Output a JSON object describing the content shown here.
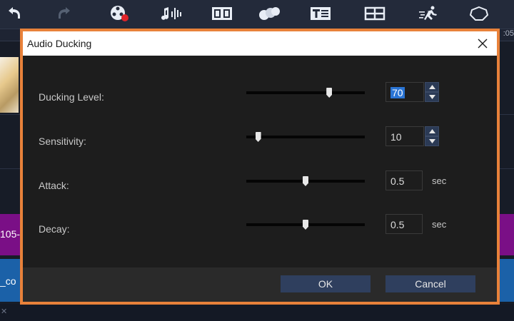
{
  "app": {
    "toolbar_icons": [
      "undo-icon",
      "redo-icon",
      "record-icon",
      "audio-icon",
      "scenes-icon",
      "merge-icon",
      "title-icon",
      "grid-icon",
      "motion-icon",
      "lasso-icon"
    ],
    "ruler_time": ":05",
    "purple_track_label": "105-",
    "blue_track_label": "_co"
  },
  "dialog": {
    "title": "Audio Ducking",
    "close_label": "✕",
    "controls": [
      {
        "label": "Ducking Level:",
        "value": "70",
        "level": 0.7,
        "has_spinner": true,
        "unit": ""
      },
      {
        "label": "Sensitivity:",
        "value": "10",
        "level": 0.1,
        "has_spinner": true,
        "unit": ""
      },
      {
        "label": "Attack:",
        "value": "0.5",
        "level": 0.5,
        "has_spinner": false,
        "unit": "sec"
      },
      {
        "label": "Decay:",
        "value": "0.5",
        "level": 0.5,
        "has_spinner": false,
        "unit": "sec"
      }
    ],
    "ok_label": "OK",
    "cancel_label": "Cancel"
  },
  "colors": {
    "highlight_border": "#e8813a",
    "dialog_bg": "#1d1d1d",
    "purple_track": "#7a0f86",
    "blue_track": "#1b61a8",
    "button_bg": "#2f3f5e"
  }
}
